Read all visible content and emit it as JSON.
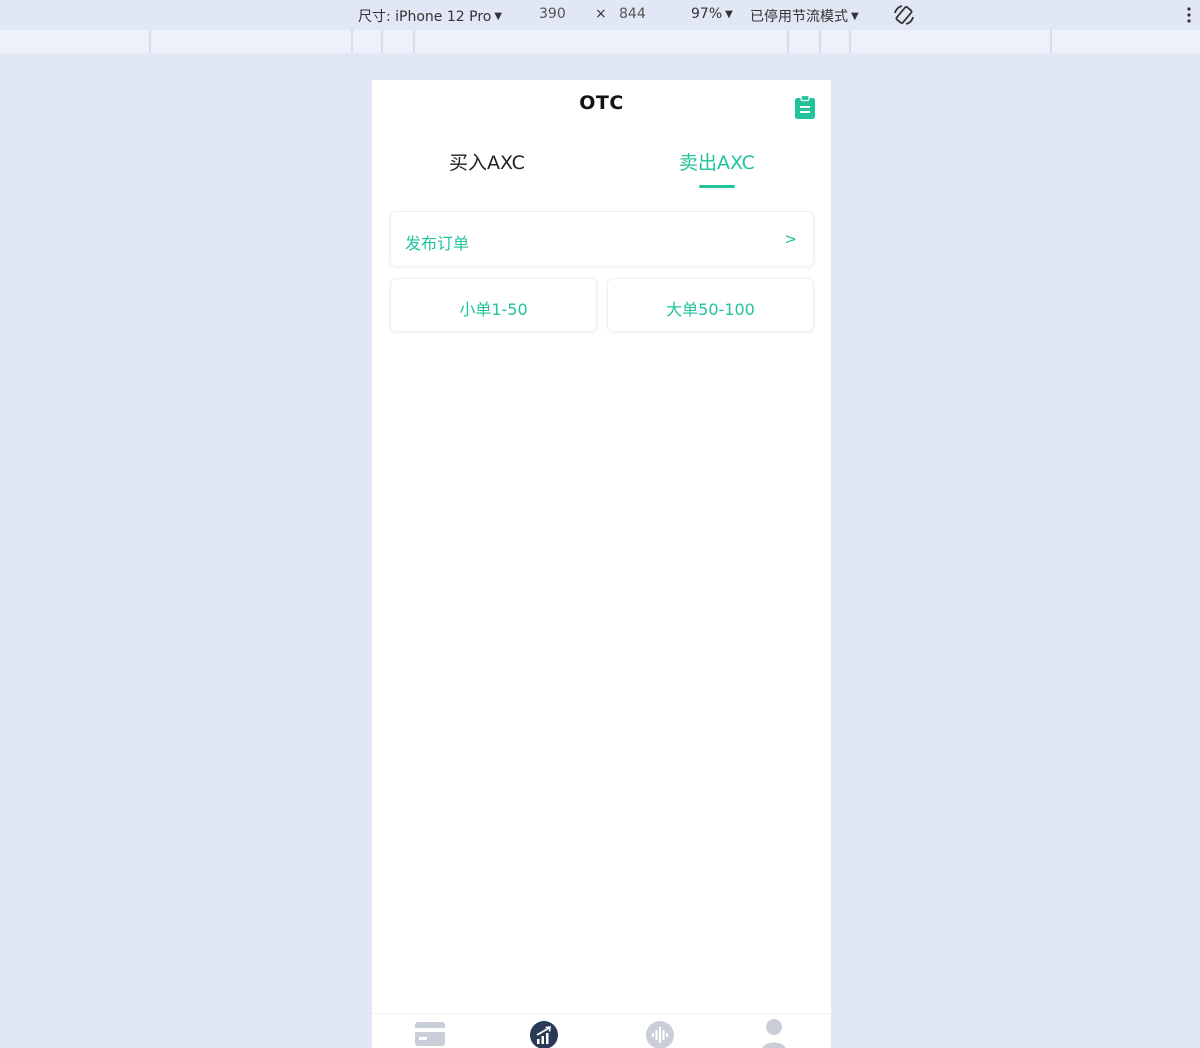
{
  "devtools": {
    "device_label": "尺寸: iPhone 12 Pro",
    "width": "390",
    "times": "×",
    "height": "844",
    "zoom": "97%",
    "throttle": "已停用节流模式"
  },
  "header": {
    "title": "OTC"
  },
  "tabs": [
    {
      "label": "买入AXC",
      "active": false
    },
    {
      "label": "卖出AXC",
      "active": true
    }
  ],
  "publish": {
    "label": "发布订单",
    "arrow": ">"
  },
  "order_types": [
    {
      "label": "小单1-50"
    },
    {
      "label": "大单50-100"
    }
  ],
  "bottom_nav": [
    {
      "icon": "card-icon",
      "active": false
    },
    {
      "icon": "trade-chart-icon",
      "active": true
    },
    {
      "icon": "sound-wave-icon",
      "active": false
    },
    {
      "icon": "user-icon",
      "active": false
    }
  ],
  "colors": {
    "accent": "#22c39b",
    "page_bg": "#e1e7f5",
    "active_nav": "#2a3a55",
    "inactive_nav": "#c9ced8"
  }
}
